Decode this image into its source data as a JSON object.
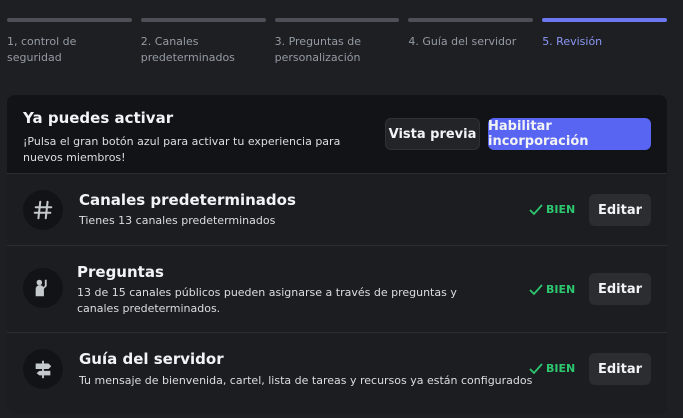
{
  "steps": [
    {
      "label": "1, control de seguridad"
    },
    {
      "label": "2. Canales predeterminados"
    },
    {
      "label": "3. Preguntas de personalización"
    },
    {
      "label": "4. Guía del servidor"
    },
    {
      "label": "5. Revisión"
    }
  ],
  "hero": {
    "title": "Ya puedes activar",
    "subtitle": "¡Pulsa el gran botón azul para activar tu experiencia para nuevos miembros!",
    "preview_label": "Vista previa",
    "enable_label": "Habilitar incorporación"
  },
  "sections": [
    {
      "icon": "hashtag-icon",
      "title": "Canales predeterminados",
      "description": "Tienes 13 canales predeterminados",
      "status": "BIEN",
      "edit_label": "Editar"
    },
    {
      "icon": "person-raising-hand-icon",
      "title": "Preguntas",
      "description": "13 de 15 canales públicos pueden asignarse a través de preguntas y canales predeterminados.",
      "status": "BIEN",
      "edit_label": "Editar"
    },
    {
      "icon": "signpost-icon",
      "title": "Guía del servidor",
      "description": "Tu mensaje de bienvenida, cartel, lista de tareas y recursos ya están configurados",
      "status": "BIEN",
      "edit_label": "Editar"
    }
  ],
  "colors": {
    "accent": "#5865f2",
    "success": "#2dc770",
    "background": "#1e1f23"
  }
}
